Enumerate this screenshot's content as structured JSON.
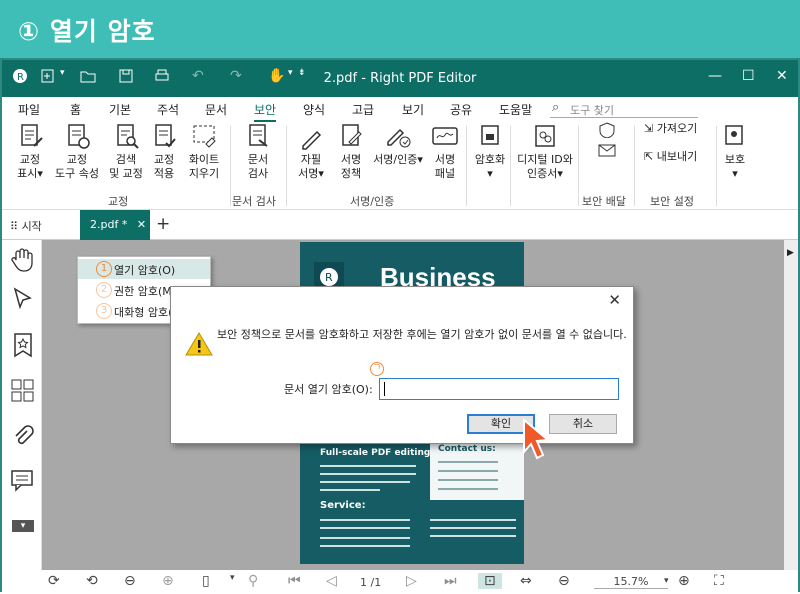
{
  "banner": {
    "number": "①",
    "title": "열기 암호"
  },
  "app": {
    "title": "2.pdf - Right PDF Editor"
  },
  "menu": [
    "파일",
    "홈",
    "기본",
    "주석",
    "문서",
    "보안",
    "양식",
    "고급",
    "보기",
    "공유",
    "도움말"
  ],
  "search": {
    "placeholder": "도구 찾기"
  },
  "ribbon": {
    "correction": {
      "mark_line1": "교정",
      "mark_line2": "표시",
      "props_line1": "교정",
      "props_line2": "도구 속성",
      "search_line1": "검색",
      "search_line2": "및 교정",
      "apply_line1": "교정",
      "apply_line2": "적용",
      "whiteout_line1": "화이트",
      "whiteout_line2": "지우기",
      "group": "교정"
    },
    "inspect": {
      "btn_line1": "문서",
      "btn_line2": "검사",
      "group": "문서 검사"
    },
    "sign": {
      "handwrite_line1": "자필",
      "handwrite_line2": "서명",
      "policy_line1": "서명",
      "policy_line2": "정책",
      "signcert_line1": "서명/인증",
      "signcert_line2": "",
      "panel_line1": "서명",
      "panel_line2": "패널",
      "group": "서명/인증"
    },
    "encrypt": {
      "btn": "암호화"
    },
    "digital": {
      "line1": "디지털 ID와",
      "line2": "인증서"
    },
    "distribute": {
      "group": "보안 배달"
    },
    "settings": {
      "import": "가져오기",
      "export": "내보내기",
      "group": "보안 설정"
    },
    "protect": {
      "btn": "보호"
    }
  },
  "tabs": {
    "start": "시작",
    "doc": "2.pdf *",
    "close": "✕",
    "add": "+"
  },
  "document": {
    "heading": "Business",
    "subheading": "Full-scale PDF editing",
    "contact": "Contact us:",
    "service": "Service:"
  },
  "context_menu": {
    "item1": "열기 암호(O)",
    "item1_num": "1",
    "item2": "권한 암호(M)",
    "item2_num": "2",
    "item3": "대화형 암호(I)",
    "item3_num": "3"
  },
  "dialog": {
    "message": "보안 정책으로 문서를 암호화하고 저장한 후에는 열기 암호가 없이 문서를 열 수 없습니다.",
    "field_label": "문서 열기 암호(O):",
    "field_value": "",
    "ok": "확인",
    "cancel": "취소",
    "annotation": "ㄱ"
  },
  "status": {
    "page": "1 /1",
    "zoom": "15.7%"
  },
  "colors": {
    "banner": "#3fbeb7",
    "titlebar": "#0d6e66",
    "doc_teal": "#155c64",
    "accent_orange": "#f08a3c"
  }
}
